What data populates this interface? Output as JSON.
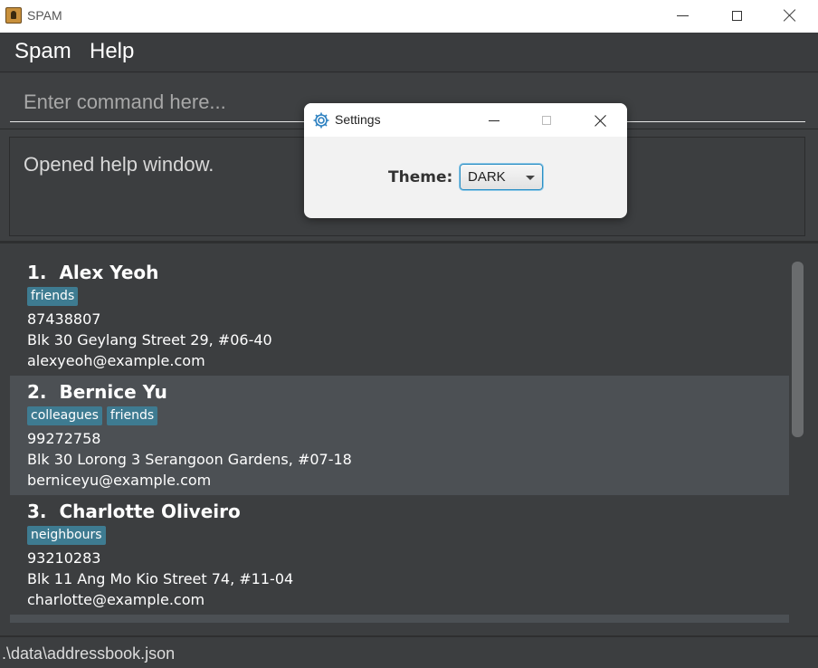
{
  "window": {
    "title": "SPAM"
  },
  "menu": {
    "items": [
      {
        "label": "Spam"
      },
      {
        "label": "Help"
      }
    ]
  },
  "command": {
    "placeholder": "Enter command here...",
    "value": ""
  },
  "result": {
    "text": "Opened help window."
  },
  "persons": [
    {
      "index": "1.",
      "name": "Alex Yeoh",
      "tags": [
        "friends"
      ],
      "phone": "87438807",
      "address": "Blk 30 Geylang Street 29, #06-40",
      "email": "alexyeoh@example.com"
    },
    {
      "index": "2.",
      "name": "Bernice Yu",
      "tags": [
        "colleagues",
        "friends"
      ],
      "phone": "99272758",
      "address": "Blk 30 Lorong 3 Serangoon Gardens, #07-18",
      "email": "berniceyu@example.com"
    },
    {
      "index": "3.",
      "name": "Charlotte Oliveiro",
      "tags": [
        "neighbours"
      ],
      "phone": "93210283",
      "address": "Blk 11 Ang Mo Kio Street 74, #11-04",
      "email": "charlotte@example.com"
    }
  ],
  "status": {
    "file_path": ".\\data\\addressbook.json"
  },
  "settings_dialog": {
    "title": "Settings",
    "theme_label": "Theme:",
    "theme_value": "DARK"
  },
  "colors": {
    "background": "#3c3e40",
    "tag": "#3e7b91",
    "selected_row": "#4c5054",
    "select_focus": "#2c8fc4"
  },
  "icons": {
    "app": "app-icon",
    "settings": "gear-icon",
    "dropdown": "chevron-down-icon"
  }
}
